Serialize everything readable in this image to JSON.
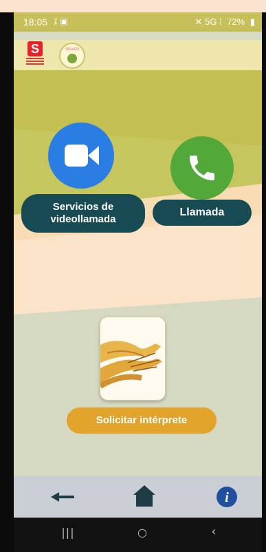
{
  "status_bar": {
    "time": "18:05",
    "left_icons": "⁒ ▣",
    "signal_text": "✕ 5G ⁞",
    "battery": "72%"
  },
  "logos": {
    "left_logo_letter": "S",
    "right_logo_text": "SilseGil"
  },
  "services": {
    "video_label": "Servicios de videollamada",
    "call_label": "Llamada",
    "interpreter_label": "Solicitar intérprete"
  },
  "app_nav": {
    "back_icon": "arrow-left",
    "home_icon": "home",
    "info_icon": "info"
  },
  "android_nav": {
    "recent": "|||",
    "home": "○",
    "back": "‹"
  },
  "colors": {
    "video_blue": "#2a7de3",
    "phone_green": "#53a83a",
    "pill_teal": "#174a52",
    "interpreter_orange": "#e2a32a",
    "nav_bar": "#c9cfd4"
  }
}
